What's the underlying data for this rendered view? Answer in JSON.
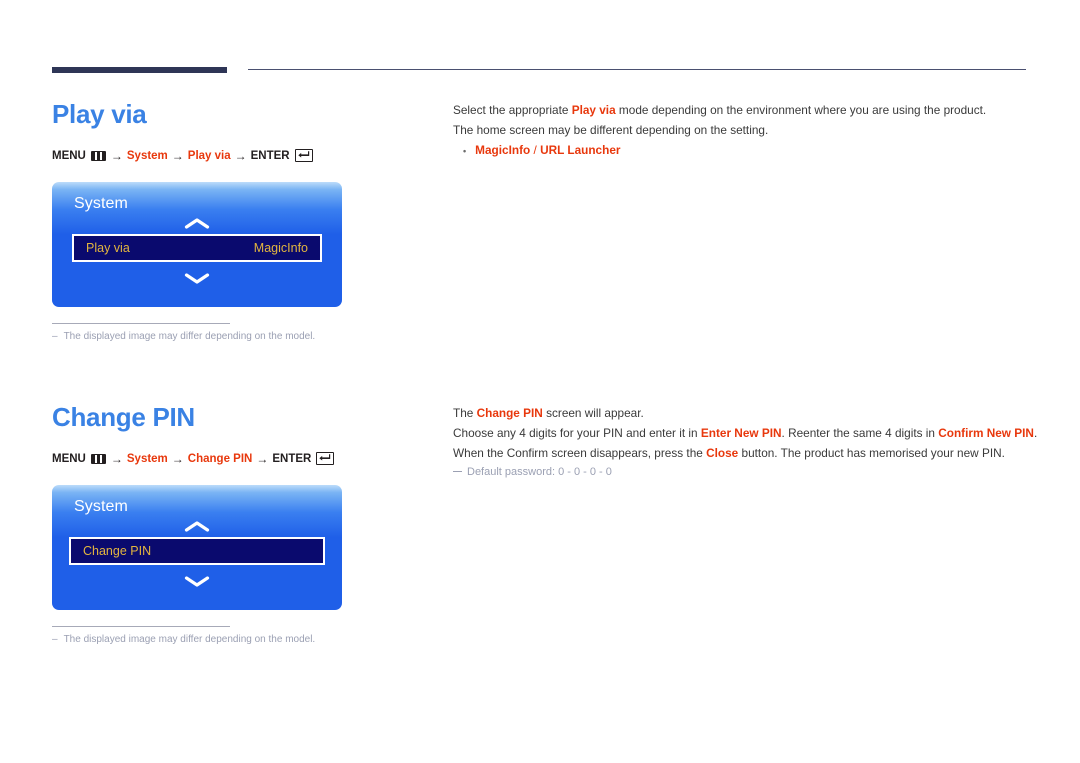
{
  "header": {
    "rule_color": "#2e3556",
    "thin_rule_color": "#4a5070"
  },
  "sections": [
    {
      "title": "Play via",
      "menu_path": {
        "menu_label": "MENU",
        "menu_icon": "menu-grid-icon",
        "arrow": "→",
        "step1": "System",
        "step2": "Play via",
        "enter_label": "ENTER",
        "enter_icon": "enter-return-icon"
      },
      "osd": {
        "title": "System",
        "up_icon": "chevron-up-icon",
        "down_icon": "chevron-down-icon",
        "row_label": "Play via",
        "row_value": "MagicInfo",
        "row_label_color": "#e3b53f",
        "row_value_color": "#e3b53f",
        "row_bg": "#0a0a6e",
        "panel_accent": "#1f5fe8"
      },
      "footnote": {
        "dash": "–",
        "text": "The displayed image may differ depending on the model."
      },
      "body": {
        "line1_a": "Select the appropriate ",
        "line1_b": "Play via",
        "line1_c": " mode depending on the environment where you are using the product.",
        "line2": "The home screen may be different depending on the setting.",
        "bullet_dot": "•",
        "bullet_a": "MagicInfo",
        "bullet_sep": " / ",
        "bullet_b": "URL Launcher"
      }
    },
    {
      "title": "Change PIN",
      "menu_path": {
        "menu_label": "MENU",
        "menu_icon": "menu-grid-icon",
        "arrow": "→",
        "step1": "System",
        "step2": "Change PIN",
        "enter_label": "ENTER",
        "enter_icon": "enter-return-icon"
      },
      "osd": {
        "title": "System",
        "up_icon": "chevron-up-icon",
        "down_icon": "chevron-down-icon",
        "row_label": "Change PIN",
        "row_value": "",
        "row_label_color": "#e3b53f",
        "row_bg": "#0a0a6e",
        "panel_accent": "#1f5fe8"
      },
      "footnote": {
        "dash": "–",
        "text": "The displayed image may differ depending on the model."
      },
      "body": {
        "line1_a": "The ",
        "line1_b": "Change PIN",
        "line1_c": " screen will appear.",
        "line2_a": "Choose any 4 digits for your PIN and enter it in ",
        "line2_b": "Enter New PIN",
        "line2_c": ". Reenter the same 4 digits in ",
        "line2_d": "Confirm New PIN",
        "line2_e": ".",
        "line3_a": "When the Confirm screen disappears, press the ",
        "line3_b": "Close",
        "line3_c": " button. The product has memorised your new PIN.",
        "note": "Default password: 0 - 0 - 0 - 0"
      }
    }
  ]
}
